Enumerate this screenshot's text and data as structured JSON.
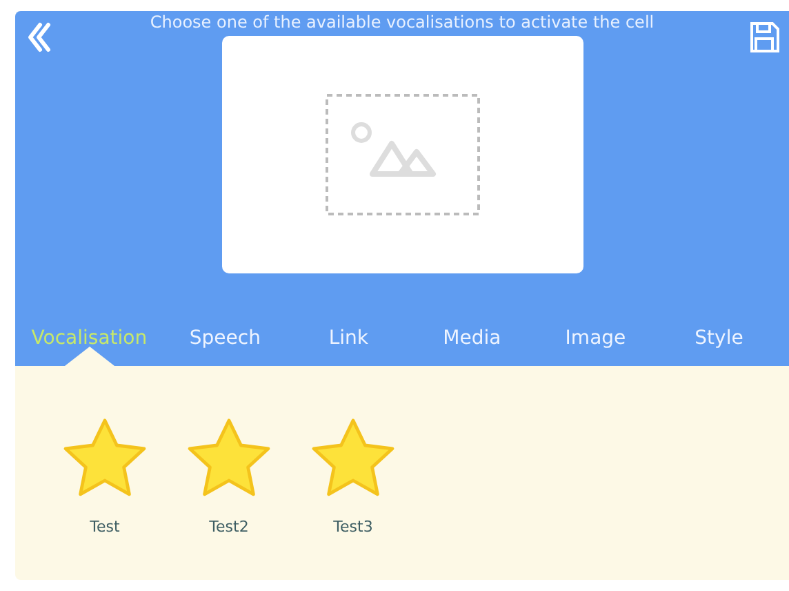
{
  "header": {
    "title": "Choose one of the available vocalisations to activate the cell"
  },
  "preview": {
    "kind": "placeholder"
  },
  "tabs": [
    {
      "label": "Vocalisation",
      "selected": true
    },
    {
      "label": "Speech",
      "selected": false
    },
    {
      "label": "Link",
      "selected": false
    },
    {
      "label": "Media",
      "selected": false
    },
    {
      "label": "Image",
      "selected": false
    },
    {
      "label": "Style",
      "selected": false
    }
  ],
  "vocalisations": [
    {
      "label": "Test"
    },
    {
      "label": "Test2"
    },
    {
      "label": "Test3"
    }
  ]
}
